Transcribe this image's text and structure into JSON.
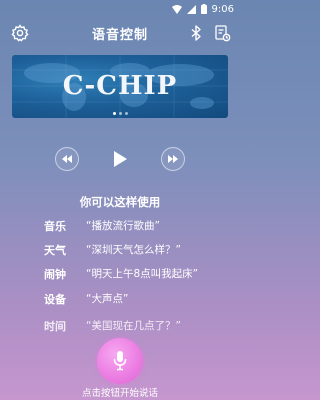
{
  "status_bar": {
    "time": "9:06"
  },
  "app_bar": {
    "title": "语音控制",
    "left_icon": "gear-icon",
    "right_icons": [
      "bluetooth-icon",
      "clipboard-icon"
    ]
  },
  "banner": {
    "text": "C-CHIP",
    "page_count": 3,
    "active_page": 1
  },
  "playback": {
    "buttons": [
      "rewind-icon",
      "play-icon",
      "fast-forward-icon"
    ]
  },
  "usage": {
    "heading": "你可以这样使用",
    "commands": [
      {
        "category": "音乐",
        "example": "“播放流行歌曲”"
      },
      {
        "category": "天气",
        "example": "“深圳天气怎么样？”"
      },
      {
        "category": "闹钟",
        "example": "“明天上午8点叫我起床”"
      },
      {
        "category": "设备",
        "example": "“大声点”"
      },
      {
        "category": "时间",
        "example": "“美国现在几点了？”"
      }
    ]
  },
  "mic": {
    "hint": "点击按钮开始说话"
  },
  "colors": {
    "mic_button": "#ec7fe3",
    "banner": "#1d5f98"
  }
}
